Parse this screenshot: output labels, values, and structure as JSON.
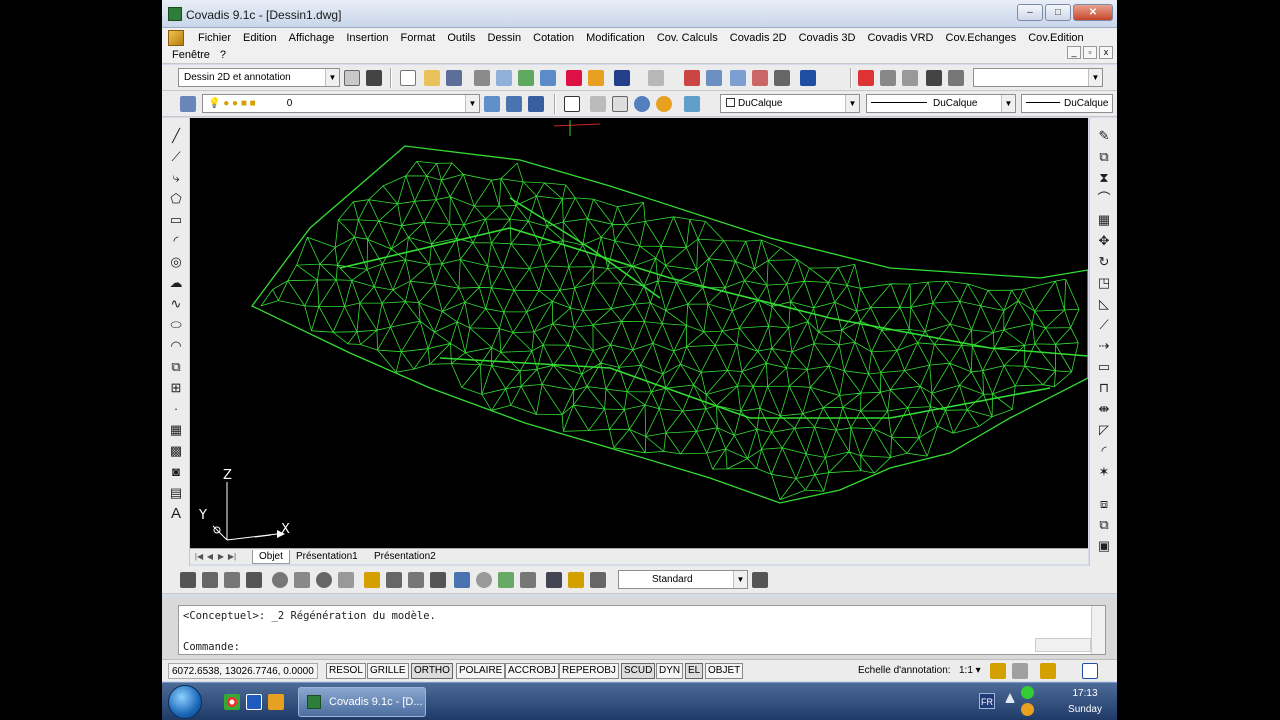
{
  "window": {
    "title": "Covadis 9.1c - [Dessin1.dwg]",
    "min": "0",
    "max": "1",
    "close": "r"
  },
  "menu": {
    "items": [
      "Fichier",
      "Edition",
      "Affichage",
      "Insertion",
      "Format",
      "Outils",
      "Dessin",
      "Cotation",
      "Modification",
      "Cov. Calculs",
      "Covadis 2D",
      "Covadis 3D",
      "Covadis VRD",
      "Cov.Echanges",
      "Cov.Edition"
    ],
    "row2": [
      "Fenêtre",
      "?"
    ],
    "mdi_min": "_",
    "mdi_restore": "▫",
    "mdi_close": "x"
  },
  "toolbar1": {
    "workspace": "Dessin 2D et annotation",
    "search_value": ""
  },
  "toolbar2": {
    "layer": "0",
    "color": "DuCalque",
    "linetype": "DuCalque",
    "lineweight": "DuCalque"
  },
  "canvas": {
    "ucs_x": "X",
    "ucs_y": "Y",
    "ucs_z": "Z",
    "mesh_color": "#33dd33"
  },
  "tabs": {
    "nav": [
      "|◀",
      "◀",
      "▶",
      "▶|"
    ],
    "items": [
      "Objet",
      "Présentation1",
      "Présentation2"
    ],
    "active": "Objet"
  },
  "dimbar": {
    "dimstyle": "Standard"
  },
  "command": {
    "history": "<Conceptuel>: _2 Régénération du modèle.",
    "prompt": "Commande:"
  },
  "status": {
    "coords": "6072.6538, 13026.7746, 0.0000",
    "buttons": [
      "RESOL",
      "GRILLE",
      "ORTHO",
      "POLAIRE",
      "ACCROBJ",
      "REPEROBJ",
      "SCUD",
      "DYN",
      "EL",
      "OBJET"
    ],
    "annotation_label": "Echelle d'annotation:",
    "annotation_scale": "1:1 ▾"
  },
  "taskbar": {
    "task_title": "Covadis 9.1c - [D...",
    "language": "FR",
    "time": "17:13",
    "day": "Sunday"
  }
}
